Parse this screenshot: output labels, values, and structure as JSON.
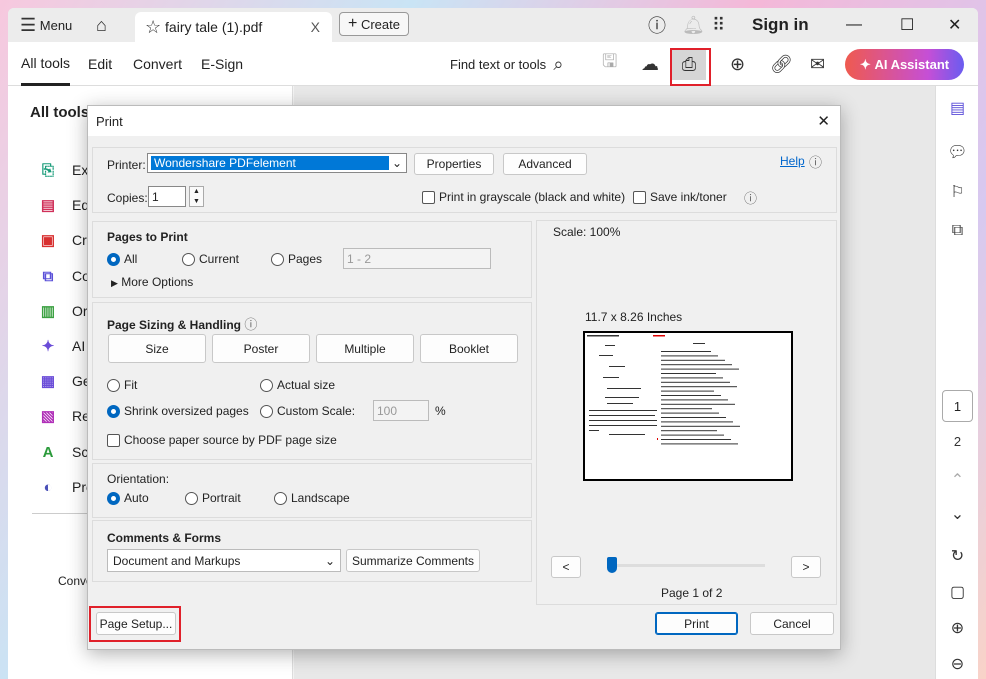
{
  "app": {
    "menu_label": "Menu",
    "tab_title": "fairy tale (1).pdf",
    "tab_close": "X",
    "create_label": "Create",
    "sign_in": "Sign in"
  },
  "toolbar": {
    "tabs": [
      "All tools",
      "Edit",
      "Convert",
      "E-Sign"
    ],
    "find_label": "Find text or tools",
    "ai_assistant": "AI Assistant",
    "ai_color": "#e8506a"
  },
  "left_panel": {
    "title": "All tools",
    "items": [
      "Exp",
      "Edi",
      "Cre",
      "Co",
      "Org",
      "AI A",
      "Ge",
      "Re",
      "Sca",
      "Pro"
    ],
    "footer": "Conve"
  },
  "right_bar": {
    "pages": [
      "1",
      "2"
    ]
  },
  "print_dialog": {
    "title": "Print",
    "close": "✕",
    "printer_label": "Printer:",
    "printer_value": "Wondershare PDFelement",
    "properties": "Properties",
    "advanced": "Advanced",
    "help": "Help",
    "copies_label": "Copies:",
    "copies_value": "1",
    "grayscale": "Print in grayscale (black and white)",
    "save_ink": "Save ink/toner",
    "pages_to_print": {
      "title": "Pages to Print",
      "options": [
        "All",
        "Current",
        "Pages"
      ],
      "selected": "All",
      "pages_placeholder": "1 - 2",
      "more_options": "More Options"
    },
    "sizing": {
      "title": "Page Sizing & Handling",
      "tabs": [
        "Size",
        "Poster",
        "Multiple",
        "Booklet"
      ],
      "fit": "Fit",
      "actual": "Actual size",
      "shrink": "Shrink oversized pages",
      "custom": "Custom Scale:",
      "custom_value": "100",
      "percent": "%",
      "paper_source": "Choose paper source by PDF page size",
      "selected": "Shrink oversized pages"
    },
    "orientation": {
      "title": "Orientation:",
      "options": [
        "Auto",
        "Portrait",
        "Landscape"
      ],
      "selected": "Auto"
    },
    "comments": {
      "title": "Comments & Forms",
      "value": "Document and Markups",
      "summarize": "Summarize Comments"
    },
    "preview": {
      "scale": "Scale: 100%",
      "size": "11.7 x 8.26 Inches",
      "prev": "<",
      "next": ">",
      "page_info": "Page 1 of 2",
      "slider_page": 1,
      "slider_total": 2
    },
    "page_setup": "Page Setup...",
    "print": "Print",
    "cancel": "Cancel"
  }
}
